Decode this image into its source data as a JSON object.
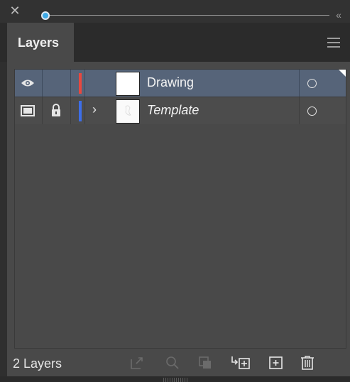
{
  "window": {
    "collapse_glyph": "«"
  },
  "tabs": [
    {
      "label": "Layers"
    }
  ],
  "layers": [
    {
      "name": "Drawing",
      "visible": true,
      "locked": false,
      "color": "#e8483f",
      "selected": true
    },
    {
      "name": "Template",
      "visible": "template",
      "locked": true,
      "color": "#3d6ee8",
      "selected": false
    }
  ],
  "footer": {
    "count_label": "2 Layers",
    "buttons": [
      "export-icon",
      "search-icon",
      "make-clipping-mask-icon",
      "move-to-layer-icon",
      "new-layer-icon",
      "trash-icon"
    ]
  },
  "colors": {
    "accent": "#3da9e6",
    "selected_row": "#566479"
  }
}
